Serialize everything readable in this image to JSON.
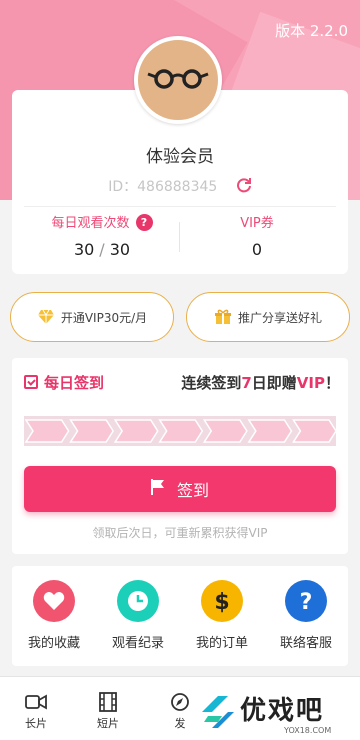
{
  "header": {
    "version_label": "版本 2.2.0"
  },
  "profile": {
    "avatar_icon": "glasses-avatar-icon",
    "member_name": "体验会员",
    "uid_text": "ID：486888345",
    "refresh_icon": "refresh-icon"
  },
  "stats": {
    "daily_views_label": "每日观看次数",
    "daily_views_used": "30",
    "daily_views_sep": "/",
    "daily_views_total": "30",
    "vip_coupon_label": "VIP券",
    "vip_coupon_value": "0"
  },
  "actions": {
    "open_vip_label": "开通VIP30元/月",
    "promote_label": "推广分享送好礼"
  },
  "checkin": {
    "title": "每日签到",
    "promo_prefix": "连续签到",
    "promo_days": "7",
    "promo_mid": "日即赠",
    "promo_vip": "VIP",
    "promo_suffix": "！",
    "progress_days_done": 0,
    "progress_days_total": 7,
    "button_label": "签到",
    "note": "领取后次日，可重新累积获得VIP"
  },
  "shortcuts": [
    {
      "label": "我的收藏",
      "icon": "heart-icon",
      "color": "#f0546f"
    },
    {
      "label": "观看纪录",
      "icon": "clock-icon",
      "color": "#1ccfb8"
    },
    {
      "label": "我的订单",
      "icon": "dollar-icon",
      "color": "#f7b500"
    },
    {
      "label": "联络客服",
      "icon": "question-icon",
      "color": "#1f6fd8"
    }
  ],
  "tabbar": [
    {
      "label": "长片",
      "icon": "video-camera-icon"
    },
    {
      "label": "短片",
      "icon": "film-icon"
    },
    {
      "label": "发",
      "icon": "discover-icon"
    }
  ],
  "watermark": {
    "text": "优戏吧",
    "url": "YOX18.COM"
  },
  "colors": {
    "accent": "#f2386c",
    "hero": "#f8a2b8",
    "gold": "#e9b04a"
  }
}
